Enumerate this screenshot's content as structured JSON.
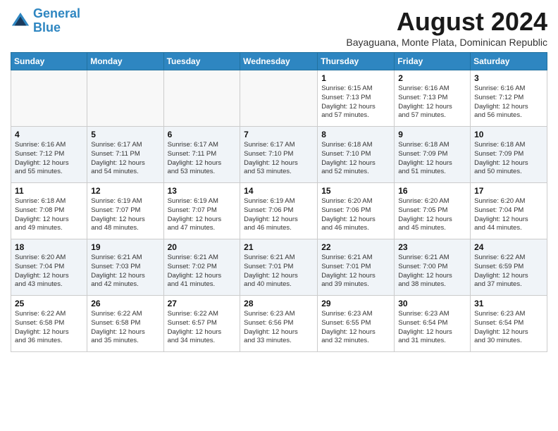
{
  "header": {
    "logo_line1": "General",
    "logo_line2": "Blue",
    "month_year": "August 2024",
    "location": "Bayaguana, Monte Plata, Dominican Republic"
  },
  "days_of_week": [
    "Sunday",
    "Monday",
    "Tuesday",
    "Wednesday",
    "Thursday",
    "Friday",
    "Saturday"
  ],
  "weeks": [
    [
      {
        "day": "",
        "info": ""
      },
      {
        "day": "",
        "info": ""
      },
      {
        "day": "",
        "info": ""
      },
      {
        "day": "",
        "info": ""
      },
      {
        "day": "1",
        "info": "Sunrise: 6:15 AM\nSunset: 7:13 PM\nDaylight: 12 hours\nand 57 minutes."
      },
      {
        "day": "2",
        "info": "Sunrise: 6:16 AM\nSunset: 7:13 PM\nDaylight: 12 hours\nand 57 minutes."
      },
      {
        "day": "3",
        "info": "Sunrise: 6:16 AM\nSunset: 7:12 PM\nDaylight: 12 hours\nand 56 minutes."
      }
    ],
    [
      {
        "day": "4",
        "info": "Sunrise: 6:16 AM\nSunset: 7:12 PM\nDaylight: 12 hours\nand 55 minutes."
      },
      {
        "day": "5",
        "info": "Sunrise: 6:17 AM\nSunset: 7:11 PM\nDaylight: 12 hours\nand 54 minutes."
      },
      {
        "day": "6",
        "info": "Sunrise: 6:17 AM\nSunset: 7:11 PM\nDaylight: 12 hours\nand 53 minutes."
      },
      {
        "day": "7",
        "info": "Sunrise: 6:17 AM\nSunset: 7:10 PM\nDaylight: 12 hours\nand 53 minutes."
      },
      {
        "day": "8",
        "info": "Sunrise: 6:18 AM\nSunset: 7:10 PM\nDaylight: 12 hours\nand 52 minutes."
      },
      {
        "day": "9",
        "info": "Sunrise: 6:18 AM\nSunset: 7:09 PM\nDaylight: 12 hours\nand 51 minutes."
      },
      {
        "day": "10",
        "info": "Sunrise: 6:18 AM\nSunset: 7:09 PM\nDaylight: 12 hours\nand 50 minutes."
      }
    ],
    [
      {
        "day": "11",
        "info": "Sunrise: 6:18 AM\nSunset: 7:08 PM\nDaylight: 12 hours\nand 49 minutes."
      },
      {
        "day": "12",
        "info": "Sunrise: 6:19 AM\nSunset: 7:07 PM\nDaylight: 12 hours\nand 48 minutes."
      },
      {
        "day": "13",
        "info": "Sunrise: 6:19 AM\nSunset: 7:07 PM\nDaylight: 12 hours\nand 47 minutes."
      },
      {
        "day": "14",
        "info": "Sunrise: 6:19 AM\nSunset: 7:06 PM\nDaylight: 12 hours\nand 46 minutes."
      },
      {
        "day": "15",
        "info": "Sunrise: 6:20 AM\nSunset: 7:06 PM\nDaylight: 12 hours\nand 46 minutes."
      },
      {
        "day": "16",
        "info": "Sunrise: 6:20 AM\nSunset: 7:05 PM\nDaylight: 12 hours\nand 45 minutes."
      },
      {
        "day": "17",
        "info": "Sunrise: 6:20 AM\nSunset: 7:04 PM\nDaylight: 12 hours\nand 44 minutes."
      }
    ],
    [
      {
        "day": "18",
        "info": "Sunrise: 6:20 AM\nSunset: 7:04 PM\nDaylight: 12 hours\nand 43 minutes."
      },
      {
        "day": "19",
        "info": "Sunrise: 6:21 AM\nSunset: 7:03 PM\nDaylight: 12 hours\nand 42 minutes."
      },
      {
        "day": "20",
        "info": "Sunrise: 6:21 AM\nSunset: 7:02 PM\nDaylight: 12 hours\nand 41 minutes."
      },
      {
        "day": "21",
        "info": "Sunrise: 6:21 AM\nSunset: 7:01 PM\nDaylight: 12 hours\nand 40 minutes."
      },
      {
        "day": "22",
        "info": "Sunrise: 6:21 AM\nSunset: 7:01 PM\nDaylight: 12 hours\nand 39 minutes."
      },
      {
        "day": "23",
        "info": "Sunrise: 6:21 AM\nSunset: 7:00 PM\nDaylight: 12 hours\nand 38 minutes."
      },
      {
        "day": "24",
        "info": "Sunrise: 6:22 AM\nSunset: 6:59 PM\nDaylight: 12 hours\nand 37 minutes."
      }
    ],
    [
      {
        "day": "25",
        "info": "Sunrise: 6:22 AM\nSunset: 6:58 PM\nDaylight: 12 hours\nand 36 minutes."
      },
      {
        "day": "26",
        "info": "Sunrise: 6:22 AM\nSunset: 6:58 PM\nDaylight: 12 hours\nand 35 minutes."
      },
      {
        "day": "27",
        "info": "Sunrise: 6:22 AM\nSunset: 6:57 PM\nDaylight: 12 hours\nand 34 minutes."
      },
      {
        "day": "28",
        "info": "Sunrise: 6:23 AM\nSunset: 6:56 PM\nDaylight: 12 hours\nand 33 minutes."
      },
      {
        "day": "29",
        "info": "Sunrise: 6:23 AM\nSunset: 6:55 PM\nDaylight: 12 hours\nand 32 minutes."
      },
      {
        "day": "30",
        "info": "Sunrise: 6:23 AM\nSunset: 6:54 PM\nDaylight: 12 hours\nand 31 minutes."
      },
      {
        "day": "31",
        "info": "Sunrise: 6:23 AM\nSunset: 6:54 PM\nDaylight: 12 hours\nand 30 minutes."
      }
    ]
  ]
}
